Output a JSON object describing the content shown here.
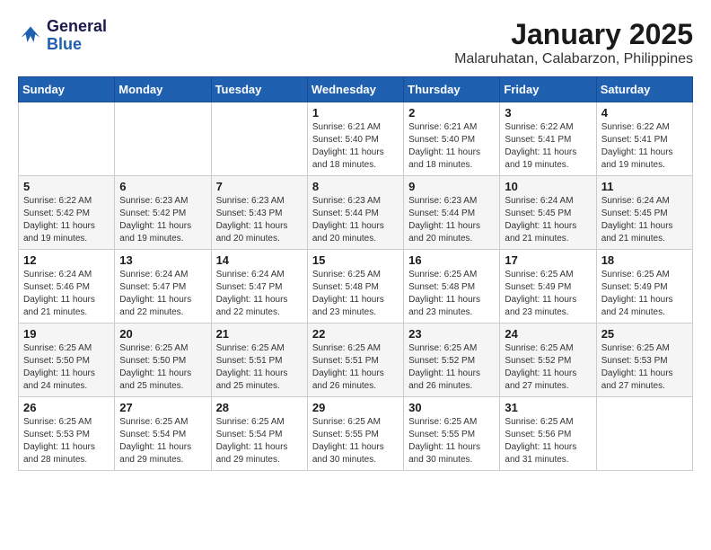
{
  "logo": {
    "line1": "General",
    "line2": "Blue"
  },
  "title": "January 2025",
  "subtitle": "Malaruhatan, Calabarzon, Philippines",
  "weekdays": [
    "Sunday",
    "Monday",
    "Tuesday",
    "Wednesday",
    "Thursday",
    "Friday",
    "Saturday"
  ],
  "weeks": [
    [
      {
        "day": "",
        "info": ""
      },
      {
        "day": "",
        "info": ""
      },
      {
        "day": "",
        "info": ""
      },
      {
        "day": "1",
        "info": "Sunrise: 6:21 AM\nSunset: 5:40 PM\nDaylight: 11 hours\nand 18 minutes."
      },
      {
        "day": "2",
        "info": "Sunrise: 6:21 AM\nSunset: 5:40 PM\nDaylight: 11 hours\nand 18 minutes."
      },
      {
        "day": "3",
        "info": "Sunrise: 6:22 AM\nSunset: 5:41 PM\nDaylight: 11 hours\nand 19 minutes."
      },
      {
        "day": "4",
        "info": "Sunrise: 6:22 AM\nSunset: 5:41 PM\nDaylight: 11 hours\nand 19 minutes."
      }
    ],
    [
      {
        "day": "5",
        "info": "Sunrise: 6:22 AM\nSunset: 5:42 PM\nDaylight: 11 hours\nand 19 minutes."
      },
      {
        "day": "6",
        "info": "Sunrise: 6:23 AM\nSunset: 5:42 PM\nDaylight: 11 hours\nand 19 minutes."
      },
      {
        "day": "7",
        "info": "Sunrise: 6:23 AM\nSunset: 5:43 PM\nDaylight: 11 hours\nand 20 minutes."
      },
      {
        "day": "8",
        "info": "Sunrise: 6:23 AM\nSunset: 5:44 PM\nDaylight: 11 hours\nand 20 minutes."
      },
      {
        "day": "9",
        "info": "Sunrise: 6:23 AM\nSunset: 5:44 PM\nDaylight: 11 hours\nand 20 minutes."
      },
      {
        "day": "10",
        "info": "Sunrise: 6:24 AM\nSunset: 5:45 PM\nDaylight: 11 hours\nand 21 minutes."
      },
      {
        "day": "11",
        "info": "Sunrise: 6:24 AM\nSunset: 5:45 PM\nDaylight: 11 hours\nand 21 minutes."
      }
    ],
    [
      {
        "day": "12",
        "info": "Sunrise: 6:24 AM\nSunset: 5:46 PM\nDaylight: 11 hours\nand 21 minutes."
      },
      {
        "day": "13",
        "info": "Sunrise: 6:24 AM\nSunset: 5:47 PM\nDaylight: 11 hours\nand 22 minutes."
      },
      {
        "day": "14",
        "info": "Sunrise: 6:24 AM\nSunset: 5:47 PM\nDaylight: 11 hours\nand 22 minutes."
      },
      {
        "day": "15",
        "info": "Sunrise: 6:25 AM\nSunset: 5:48 PM\nDaylight: 11 hours\nand 23 minutes."
      },
      {
        "day": "16",
        "info": "Sunrise: 6:25 AM\nSunset: 5:48 PM\nDaylight: 11 hours\nand 23 minutes."
      },
      {
        "day": "17",
        "info": "Sunrise: 6:25 AM\nSunset: 5:49 PM\nDaylight: 11 hours\nand 23 minutes."
      },
      {
        "day": "18",
        "info": "Sunrise: 6:25 AM\nSunset: 5:49 PM\nDaylight: 11 hours\nand 24 minutes."
      }
    ],
    [
      {
        "day": "19",
        "info": "Sunrise: 6:25 AM\nSunset: 5:50 PM\nDaylight: 11 hours\nand 24 minutes."
      },
      {
        "day": "20",
        "info": "Sunrise: 6:25 AM\nSunset: 5:50 PM\nDaylight: 11 hours\nand 25 minutes."
      },
      {
        "day": "21",
        "info": "Sunrise: 6:25 AM\nSunset: 5:51 PM\nDaylight: 11 hours\nand 25 minutes."
      },
      {
        "day": "22",
        "info": "Sunrise: 6:25 AM\nSunset: 5:51 PM\nDaylight: 11 hours\nand 26 minutes."
      },
      {
        "day": "23",
        "info": "Sunrise: 6:25 AM\nSunset: 5:52 PM\nDaylight: 11 hours\nand 26 minutes."
      },
      {
        "day": "24",
        "info": "Sunrise: 6:25 AM\nSunset: 5:52 PM\nDaylight: 11 hours\nand 27 minutes."
      },
      {
        "day": "25",
        "info": "Sunrise: 6:25 AM\nSunset: 5:53 PM\nDaylight: 11 hours\nand 27 minutes."
      }
    ],
    [
      {
        "day": "26",
        "info": "Sunrise: 6:25 AM\nSunset: 5:53 PM\nDaylight: 11 hours\nand 28 minutes."
      },
      {
        "day": "27",
        "info": "Sunrise: 6:25 AM\nSunset: 5:54 PM\nDaylight: 11 hours\nand 29 minutes."
      },
      {
        "day": "28",
        "info": "Sunrise: 6:25 AM\nSunset: 5:54 PM\nDaylight: 11 hours\nand 29 minutes."
      },
      {
        "day": "29",
        "info": "Sunrise: 6:25 AM\nSunset: 5:55 PM\nDaylight: 11 hours\nand 30 minutes."
      },
      {
        "day": "30",
        "info": "Sunrise: 6:25 AM\nSunset: 5:55 PM\nDaylight: 11 hours\nand 30 minutes."
      },
      {
        "day": "31",
        "info": "Sunrise: 6:25 AM\nSunset: 5:56 PM\nDaylight: 11 hours\nand 31 minutes."
      },
      {
        "day": "",
        "info": ""
      }
    ]
  ]
}
